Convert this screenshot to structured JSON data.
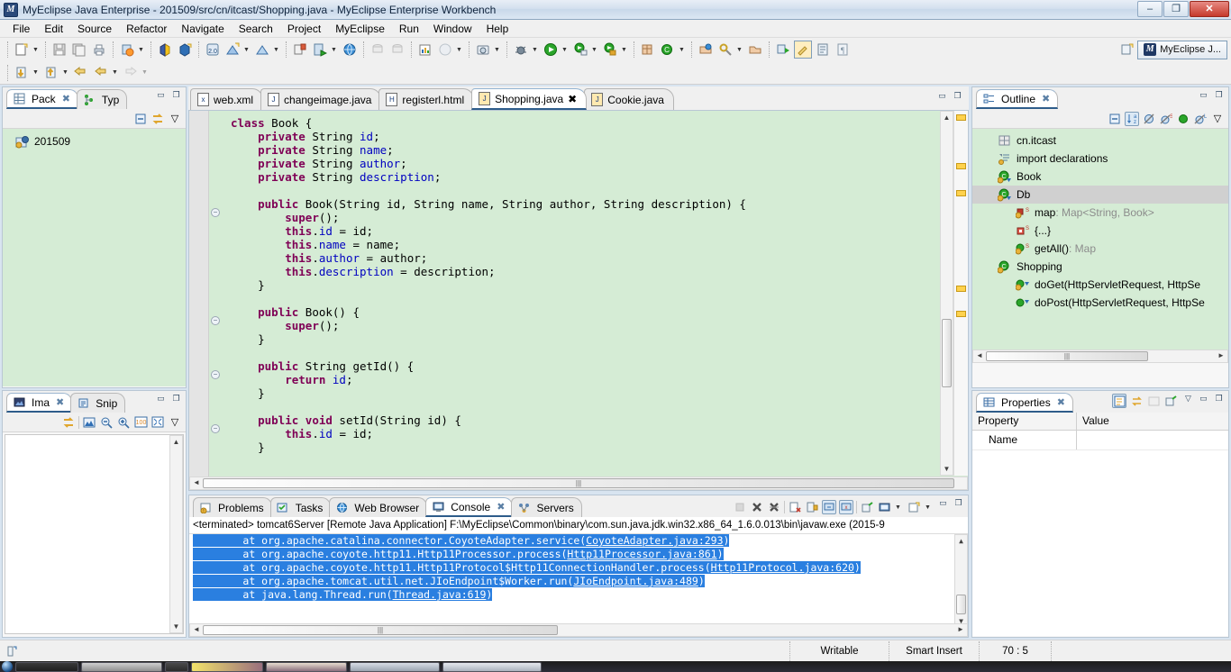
{
  "window": {
    "title": "MyEclipse Java Enterprise - 201509/src/cn/itcast/Shopping.java - MyEclipse Enterprise Workbench",
    "app_icon": "myeclipse-icon",
    "minimize": "–",
    "restore": "❐",
    "close": "✕"
  },
  "menu": [
    {
      "label": "File"
    },
    {
      "label": "Edit"
    },
    {
      "label": "Source"
    },
    {
      "label": "Refactor"
    },
    {
      "label": "Navigate"
    },
    {
      "label": "Search"
    },
    {
      "label": "Project"
    },
    {
      "label": "MyEclipse"
    },
    {
      "label": "Run"
    },
    {
      "label": "Window"
    },
    {
      "label": "Help"
    }
  ],
  "perspective": {
    "new_perspective_icon": "new-perspective-icon",
    "active_label": "MyEclipse J...",
    "logo": "myeclipse-logo-icon"
  },
  "package_explorer": {
    "tabs": [
      {
        "label": "Pack",
        "icon": "package-explorer-icon",
        "active": true,
        "closable": true
      },
      {
        "label": "Typ",
        "icon": "type-hierarchy-icon",
        "active": false,
        "closable": false
      }
    ],
    "toolbar": [
      {
        "icon": "collapse-all-icon"
      },
      {
        "icon": "link-with-editor-icon"
      },
      {
        "icon": "view-menu-icon"
      }
    ],
    "tree": [
      {
        "label": "201509",
        "icon": "java-project-icon"
      }
    ]
  },
  "image_view": {
    "tabs": [
      {
        "label": "Ima",
        "icon": "image-viewer-icon",
        "active": true,
        "closable": true
      },
      {
        "label": "Snip",
        "icon": "snippets-icon",
        "active": false,
        "closable": false
      }
    ],
    "toolbar": [
      {
        "icon": "link-with-editor-icon"
      },
      {
        "icon": "image-icon"
      },
      {
        "icon": "zoom-out-icon"
      },
      {
        "icon": "zoom-in-icon"
      },
      {
        "icon": "zoom-100-icon"
      },
      {
        "icon": "fit-image-icon"
      },
      {
        "icon": "view-menu-icon"
      }
    ]
  },
  "editor": {
    "tabs": [
      {
        "label": "web.xml",
        "icon": "xml-file-icon",
        "active": false,
        "closable": false
      },
      {
        "label": "changeimage.java",
        "icon": "java-file-icon",
        "active": false,
        "closable": false
      },
      {
        "label": "registerl.html",
        "icon": "html-file-icon",
        "active": false,
        "closable": false
      },
      {
        "label": "Shopping.java",
        "icon": "java-file-icon",
        "active": true,
        "closable": true
      },
      {
        "label": "Cookie.java",
        "icon": "java-file-icon",
        "active": false,
        "closable": false
      }
    ],
    "code_lines": [
      "class Book {",
      "    private String id;",
      "    private String name;",
      "    private String author;",
      "    private String description;",
      "",
      "    public Book(String id, String name, String author, String description) {",
      "        super();",
      "        this.id = id;",
      "        this.name = name;",
      "        this.author = author;",
      "        this.description = description;",
      "    }",
      "",
      "    public Book() {",
      "        super();",
      "    }",
      "",
      "    public String getId() {",
      "        return id;",
      "    }",
      "",
      "    public void setId(String id) {",
      "        this.id = id;",
      "    }"
    ]
  },
  "outline": {
    "tab": {
      "label": "Outline",
      "icon": "outline-icon",
      "closable": true
    },
    "toolbar": [
      {
        "icon": "collapse-all-icon"
      },
      {
        "icon": "sort-alphabetically-icon",
        "active": true
      },
      {
        "icon": "hide-fields-icon"
      },
      {
        "icon": "hide-static-icon"
      },
      {
        "icon": "hide-non-public-icon"
      },
      {
        "icon": "hide-local-types-icon"
      },
      {
        "icon": "view-menu-icon"
      }
    ],
    "tree": [
      {
        "label": "cn.itcast",
        "icon": "package-icon",
        "indent": 0,
        "type": "package"
      },
      {
        "label": "import declarations",
        "icon": "import-declarations-icon",
        "indent": 0,
        "type": "imports"
      },
      {
        "label": "Book",
        "icon": "class-icon",
        "indent": 0,
        "type": "class"
      },
      {
        "label": "Db",
        "icon": "class-icon",
        "indent": 0,
        "type": "class",
        "selected": true
      },
      {
        "label": "map",
        "type_suffix": " : Map<String, Book>",
        "icon": "private-static-field-icon",
        "indent": 1,
        "modifier": "S"
      },
      {
        "label": "{...}",
        "icon": "static-initializer-icon",
        "indent": 1,
        "modifier": "S"
      },
      {
        "label": "getAll()",
        "type_suffix": " : Map",
        "icon": "public-static-method-icon",
        "indent": 1,
        "modifier": "S"
      },
      {
        "label": "Shopping",
        "icon": "class-icon",
        "indent": 0,
        "type": "class"
      },
      {
        "label": "doGet(HttpServletRequest, HttpSe",
        "icon": "protected-method-icon",
        "indent": 1
      },
      {
        "label": "doPost(HttpServletRequest, HttpSe",
        "icon": "public-method-icon",
        "indent": 1
      }
    ]
  },
  "properties": {
    "tab": {
      "label": "Properties",
      "icon": "properties-icon",
      "closable": true
    },
    "toolbar": [
      {
        "icon": "show-categories-icon",
        "active": true
      },
      {
        "icon": "show-advanced-icon"
      },
      {
        "icon": "restore-default-icon"
      },
      {
        "icon": "pin-to-selection-icon"
      },
      {
        "icon": "view-menu-icon"
      }
    ],
    "columns": [
      "Property",
      "Value"
    ],
    "rows": [
      {
        "property": "Name",
        "value": ""
      }
    ]
  },
  "bottom_panel": {
    "tabs": [
      {
        "label": "Problems",
        "icon": "problems-icon",
        "active": false,
        "closable": false
      },
      {
        "label": "Tasks",
        "icon": "tasks-icon",
        "active": false,
        "closable": false
      },
      {
        "label": "Web Browser",
        "icon": "web-browser-icon",
        "active": false,
        "closable": false
      },
      {
        "label": "Console",
        "icon": "console-icon",
        "active": true,
        "closable": true
      },
      {
        "label": "Servers",
        "icon": "servers-icon",
        "active": false,
        "closable": false
      }
    ],
    "toolbar": [
      {
        "icon": "terminate-icon",
        "enabled": false
      },
      {
        "icon": "remove-launch-icon"
      },
      {
        "icon": "remove-all-terminated-icon"
      },
      {
        "icon": "clear-console-icon"
      },
      {
        "icon": "scroll-lock-icon"
      },
      {
        "icon": "show-console-on-output-icon",
        "active": true
      },
      {
        "icon": "show-console-on-error-icon",
        "active": true
      },
      {
        "icon": "pin-console-icon"
      },
      {
        "icon": "display-selected-console-icon"
      },
      {
        "icon": "display-selected-console-arrow"
      },
      {
        "icon": "open-console-icon"
      },
      {
        "icon": "open-console-arrow"
      },
      {
        "icon": "minimize-icon"
      },
      {
        "icon": "maximize-icon"
      }
    ],
    "console_header": "<terminated> tomcat6Server [Remote Java Application] F:\\MyEclipse\\Common\\binary\\com.sun.java.jdk.win32.x86_64_1.6.0.013\\bin\\javaw.exe (2015-9",
    "console_lines": [
      {
        "pre": "\tat org.apache.catalina.connector.CoyoteAdapter.service(",
        "link": "CoyoteAdapter.java:293",
        "post": ")"
      },
      {
        "pre": "\tat org.apache.coyote.http11.Http11Processor.process(",
        "link": "Http11Processor.java:861",
        "post": ")"
      },
      {
        "pre": "\tat org.apache.coyote.http11.Http11Protocol$Http11ConnectionHandler.process(",
        "link": "Http11Protocol.java:620",
        "post": ")"
      },
      {
        "pre": "\tat org.apache.tomcat.util.net.JIoEndpoint$Worker.run(",
        "link": "JIoEndpoint.java:489",
        "post": ")"
      },
      {
        "pre": "\tat java.lang.Thread.run(",
        "link": "Thread.java:619",
        "post": ")"
      }
    ]
  },
  "status_bar": {
    "left_icon": "smart-insert-icon",
    "writable": "Writable",
    "insert_mode": "Smart Insert",
    "cursor_position": "70 : 5"
  },
  "colors": {
    "editor_background": "#d5ecd5",
    "keyword": "#7f0055",
    "field": "#0000c0",
    "console_selection": "#2a7fe0",
    "tab_active_underline": "#2e5c8a",
    "marker_warning": "#ffd24d"
  }
}
